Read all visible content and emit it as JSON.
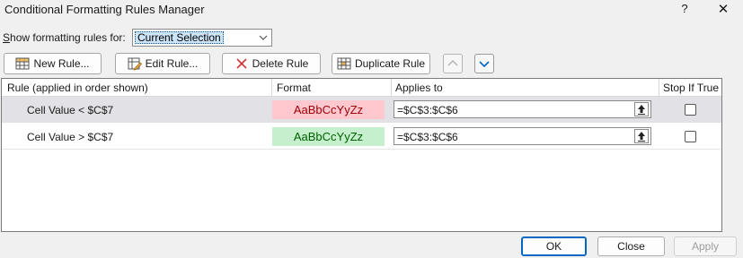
{
  "window": {
    "title": "Conditional Formatting Rules Manager",
    "help_glyph": "?",
    "close_glyph": "✕"
  },
  "show_rules": {
    "label": "Show formatting rules for:",
    "selected": "Current Selection"
  },
  "toolbar": {
    "new_rule": "New Rule...",
    "edit_rule": "Edit Rule...",
    "delete_rule": "Delete Rule",
    "duplicate_rule": "Duplicate Rule"
  },
  "grid": {
    "headers": {
      "rule": "Rule (applied in order shown)",
      "format": "Format",
      "applies_to": "Applies to",
      "stop_if_true": "Stop If True"
    },
    "rows": [
      {
        "rule": "Cell Value < $C$7",
        "format_preview": "AaBbCcYyZz",
        "format_bg": "#ffc7ce",
        "format_fg": "#9c0006",
        "applies_to": "=$C$3:$C$6",
        "stop_if_true": false,
        "selected": true
      },
      {
        "rule": "Cell Value > $C$7",
        "format_preview": "AaBbCcYyZz",
        "format_bg": "#c6efce",
        "format_fg": "#006100",
        "applies_to": "=$C$3:$C$6",
        "stop_if_true": false,
        "selected": false
      }
    ]
  },
  "footer": {
    "ok": "OK",
    "close": "Close",
    "apply": "Apply"
  },
  "colors": {
    "accent": "#0067c0",
    "selection_row": "#e1e1e6",
    "delete_icon": "#d13438"
  }
}
